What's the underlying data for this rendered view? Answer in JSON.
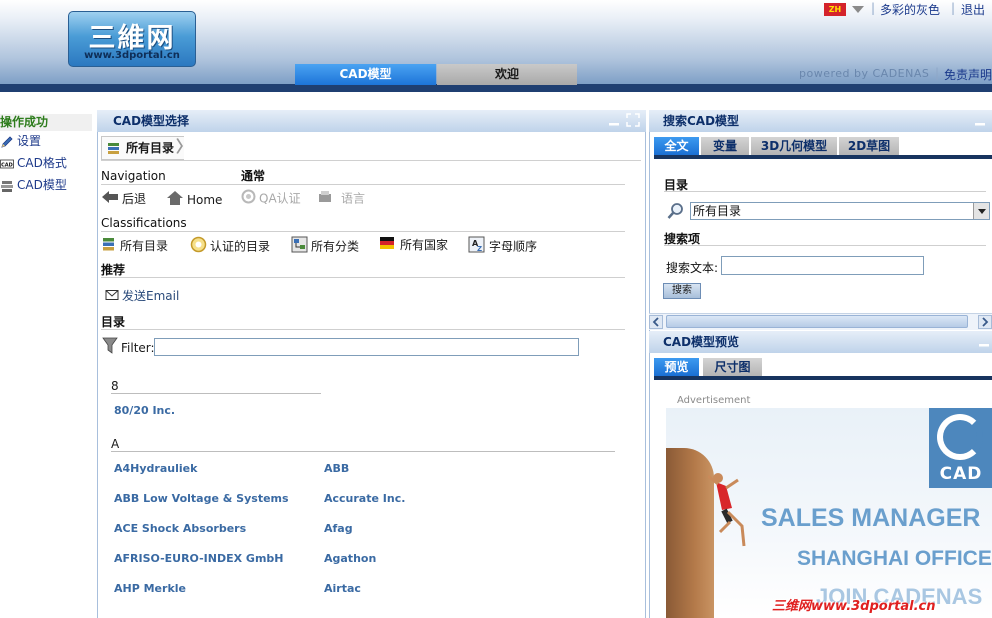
{
  "header": {
    "logo_text": "三維网",
    "logo_url": "www.3dportal.cn",
    "lang_code": "ZH",
    "link_theme": "多彩的灰色",
    "link_logout": "退出",
    "separator": "|",
    "powered_by": "powered by CADENAS",
    "disclaimer": "免责声明",
    "tabs": [
      {
        "label": "CAD模型",
        "active": true
      },
      {
        "label": "欢迎",
        "active": false
      }
    ]
  },
  "sidebar": {
    "status": "操作成功",
    "items": [
      {
        "label": "设置",
        "icon": "pencil-icon"
      },
      {
        "label": "CAD格式",
        "icon": "cad-format-icon"
      },
      {
        "label": "CAD模型",
        "icon": "cad-model-icon"
      }
    ]
  },
  "center": {
    "title": "CAD模型选择",
    "breadcrumb": "所有目录",
    "navigation": {
      "title": "Navigation",
      "general_title": "通常",
      "back": "后退",
      "home": "Home",
      "qa": "QA认证",
      "language": "语言"
    },
    "classifications": {
      "title": "Classifications",
      "items": [
        "所有目录",
        "认证的目录",
        "所有分类",
        "所有国家",
        "字母顺序"
      ]
    },
    "recommend": {
      "title": "推荐",
      "send_email": "发送Email"
    },
    "catalog": {
      "title": "目录",
      "filter_label": "Filter:",
      "filter_value": "",
      "groups": [
        {
          "letter": "8",
          "companies": [
            "80/20 Inc."
          ]
        },
        {
          "letter": "A",
          "companies": [
            "A4Hydrauliek",
            "ABB",
            "ABB Low Voltage & Systems",
            "Accurate Inc.",
            "ACE Shock Absorbers",
            "Afag",
            "AFRISO-EURO-INDEX GmbH",
            "Agathon",
            "AHP Merkle",
            "Airtac"
          ]
        }
      ]
    }
  },
  "right": {
    "search_title": "搜索CAD模型",
    "search_tabs": [
      "全文",
      "变量",
      "3D几何模型",
      "2D草图"
    ],
    "directory_label": "目录",
    "directory_value": "所有目录",
    "search_terms_label": "搜索项",
    "search_text_label": "搜索文本:",
    "search_text_value": "",
    "search_button": "搜索",
    "preview_title": "CAD模型预览",
    "preview_tabs": [
      "预览",
      "尺寸图"
    ],
    "advertisement_label": "Advertisement",
    "ad": {
      "logo": "CAD",
      "line1": "SALES MANAGER",
      "line2": "SHANGHAI OFFICE",
      "line3": "JOIN CADENAS"
    },
    "watermark": "三维网www.3dportal.cn"
  },
  "colors": {
    "accent_blue": "#1d74d8",
    "header_dark": "#1f3f71",
    "link": "#1b3a8c",
    "success_green": "#2e7d1d",
    "company_link": "#3a6aa3"
  }
}
